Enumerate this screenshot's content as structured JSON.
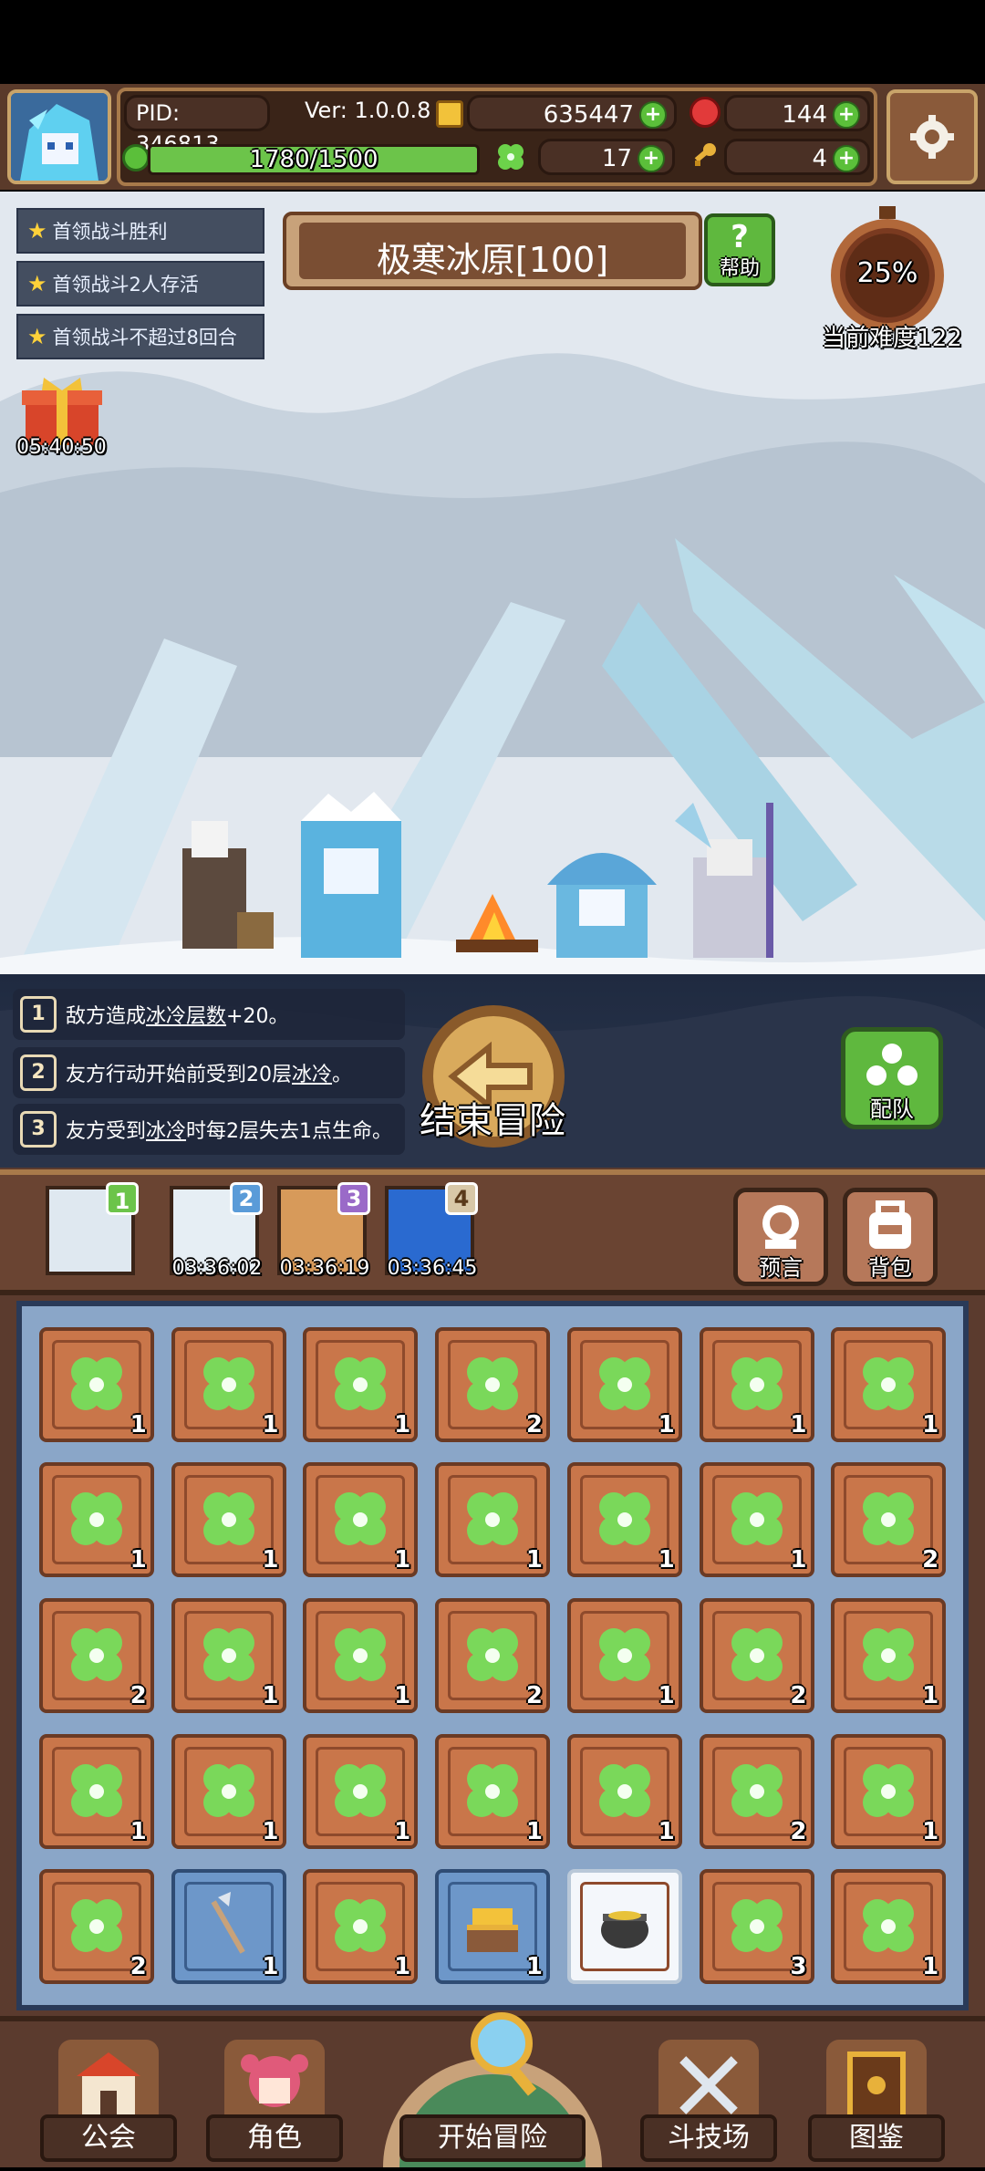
{
  "status_bar": {},
  "header": {
    "pid_label": "PID: 346813",
    "version_label": "Ver: 1.0.0.8",
    "gold_value": "635447",
    "gem_value": "144",
    "clover_value": "17",
    "key_value": "4",
    "exp_text": "1780/1500",
    "exp_progress": 1.0
  },
  "quests": [
    {
      "label": "首领战斗胜利"
    },
    {
      "label": "首领战斗2人存活"
    },
    {
      "label": "首领战斗不超过8回合"
    }
  ],
  "gift_timer": "05:40:50",
  "stage": {
    "title": "极寒冰原[100]",
    "help_label": "帮助"
  },
  "difficulty": {
    "percent": "25%",
    "label": "当前难度122"
  },
  "rules": [
    {
      "num": "1",
      "pre": "敌方造成",
      "key": "冰冷层数",
      "post": "+20。"
    },
    {
      "num": "2",
      "pre": "友方行动开始前受到20层",
      "key": "冰冷",
      "post": "。"
    },
    {
      "num": "3",
      "pre": "友方受到",
      "key": "冰冷",
      "post": "时每2层失去1点生命。"
    }
  ],
  "end_adventure_label": "结束冒险",
  "team_label": "配队",
  "stage_tabs": [
    {
      "num": "1",
      "timer": ""
    },
    {
      "num": "2",
      "timer": "03:36:02"
    },
    {
      "num": "3",
      "timer": "03:36:19"
    },
    {
      "num": "4",
      "timer": "03:36:45"
    }
  ],
  "prophecy_label": "预言",
  "backpack_label": "背包",
  "inventory": [
    {
      "icon": "clover-icon",
      "count": "1"
    },
    {
      "icon": "clover-icon",
      "count": "1"
    },
    {
      "icon": "clover-icon",
      "count": "1"
    },
    {
      "icon": "clover-icon",
      "count": "2"
    },
    {
      "icon": "clover-icon",
      "count": "1"
    },
    {
      "icon": "clover-icon",
      "count": "1"
    },
    {
      "icon": "clover-icon",
      "count": "1"
    },
    {
      "icon": "clover-icon",
      "count": "1"
    },
    {
      "icon": "clover-icon",
      "count": "1"
    },
    {
      "icon": "clover-icon",
      "count": "1"
    },
    {
      "icon": "clover-icon",
      "count": "1"
    },
    {
      "icon": "clover-icon",
      "count": "1"
    },
    {
      "icon": "clover-icon",
      "count": "1"
    },
    {
      "icon": "clover-icon",
      "count": "2"
    },
    {
      "icon": "clover-icon",
      "count": "2"
    },
    {
      "icon": "clover-icon",
      "count": "1"
    },
    {
      "icon": "clover-icon",
      "count": "1"
    },
    {
      "icon": "clover-icon",
      "count": "2"
    },
    {
      "icon": "clover-icon",
      "count": "1"
    },
    {
      "icon": "clover-icon",
      "count": "2"
    },
    {
      "icon": "clover-icon",
      "count": "1"
    },
    {
      "icon": "clover-icon",
      "count": "1"
    },
    {
      "icon": "clover-icon",
      "count": "1"
    },
    {
      "icon": "clover-icon",
      "count": "1"
    },
    {
      "icon": "clover-icon",
      "count": "1"
    },
    {
      "icon": "clover-icon",
      "count": "1"
    },
    {
      "icon": "clover-icon",
      "count": "2"
    },
    {
      "icon": "clover-icon",
      "count": "1"
    },
    {
      "icon": "clover-icon",
      "count": "2"
    },
    {
      "icon": "arrow-icon",
      "count": "1"
    },
    {
      "icon": "clover-icon",
      "count": "1"
    },
    {
      "icon": "gold-chest-icon",
      "count": "1"
    },
    {
      "icon": "cauldron-icon",
      "count": ""
    },
    {
      "icon": "clover-icon",
      "count": "3"
    },
    {
      "icon": "clover-icon",
      "count": "1"
    }
  ],
  "nav": [
    {
      "label": "公会",
      "icon": "guild-icon"
    },
    {
      "label": "角色",
      "icon": "character-icon"
    },
    {
      "label": "开始冒险",
      "icon": "map-search-icon"
    },
    {
      "label": "斗技场",
      "icon": "crossed-swords-icon"
    },
    {
      "label": "图鉴",
      "icon": "book-icon"
    }
  ],
  "colors": {
    "accent_green": "#5bbf3a",
    "frame_brown": "#5b3b2e",
    "slot_orange": "#c9764a"
  }
}
